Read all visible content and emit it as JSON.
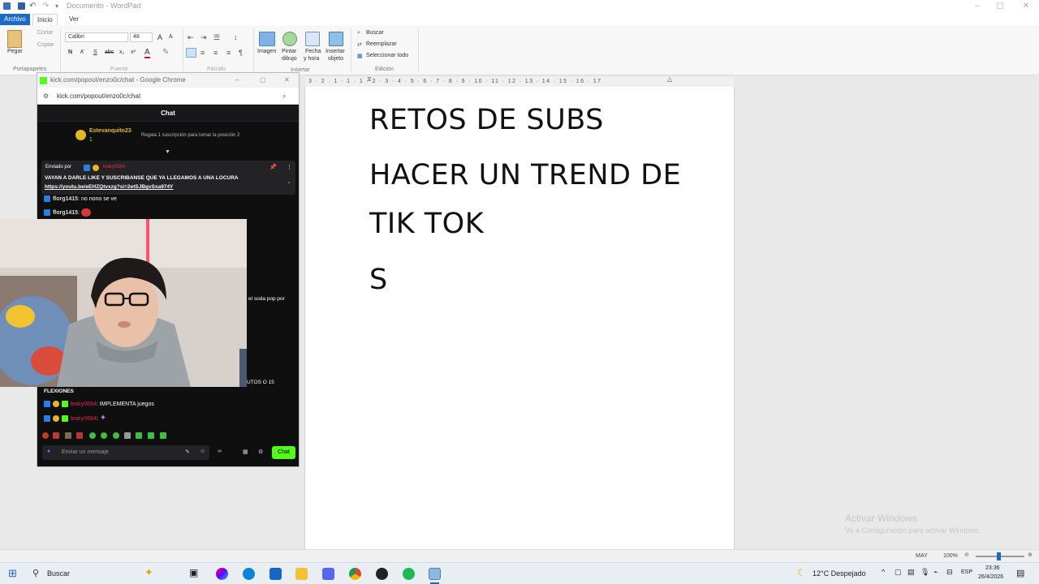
{
  "window": {
    "title": "Documento - WordPad"
  },
  "tabs": {
    "file": "Archivo",
    "home": "Inicio",
    "view": "Ver"
  },
  "ribbon": {
    "paste": "Pegar",
    "cut": "Cortar",
    "copy": "Copiar",
    "clipboard_group": "Portapapeles",
    "font_name": "Calibri",
    "font_size": "48",
    "font_group": "Fuente",
    "paragraph_group": "Párrafo",
    "image": "Imagen",
    "paint_drawing": "Pintar\ndibujo",
    "paint_line1": "Pintar",
    "paint_line2": "dibujo",
    "date_line1": "Fecha",
    "date_line2": "y hora",
    "insert_line1": "Insertar",
    "insert_line2": "objeto",
    "insert_group": "Insertar",
    "find": "Buscar",
    "replace": "Reemplazar",
    "select_all": "Seleccionar todo",
    "edit_group": "Edición",
    "bold": "N",
    "italic": "K",
    "underline": "S",
    "strike": "abc",
    "sub": "x₂",
    "sup": "x²"
  },
  "ruler": {
    "marks": "3 · 2 · 1 · 1 · 1 · 2 · 3 · 4 · 5 · 6 · 7 · 8 · 9 · 10 · 11 · 12 · 13 · 14 · 15 · 16 · 17"
  },
  "document": {
    "lines": [
      "RETOS DE SUBS",
      "HACER UN TREND DE",
      "TIK TOK",
      "S"
    ]
  },
  "chrome": {
    "title": "kick.com/popout/enzo0c/chat - Google Chrome",
    "url": "kick.com/popout/enzo0c/chat",
    "chat_header": "Chat",
    "top_user": "Estevanquito23",
    "top_count": "1",
    "gift_text": "Regala 1 suscripción para tomar la posición 2",
    "pinned_by": "Enviado por",
    "pinned_user": "leaky0694",
    "pinned_message": "VAYAN A DARLE LIKE Y SUSCRIBANSE QUE YA LLEGAMOS A UNA LOCURA",
    "pinned_link": "https://youtu.be/eEHZQtvxzg?si=2etSJBgvSxa974Y",
    "msg1_user": "florg1415",
    "msg1_text": ": no nono se ve",
    "msg2_user": "florg1415",
    "msg2_text": ":",
    "partial1": "el soda pop por",
    "partial2": "UTOS O 15",
    "msg3_text": "FLEXIONES",
    "msg4_user": "leaky0694",
    "msg4_text": ": IMPLEMENTA juegos",
    "msg5_user": "leaky0694",
    "msg5_text": ":",
    "input_placeholder": "Enviar un mensaje",
    "chat_button": "Chat"
  },
  "watermark": {
    "line1": "Activar Windows",
    "line2": "Ve a Configuración para activar Windows."
  },
  "statusbar": {
    "caps": "MAY",
    "zoom": "100%"
  },
  "taskbar": {
    "search": "Buscar",
    "weather": "12°C  Despejado",
    "lang": "ESP",
    "time": "23:36",
    "date": "26/4/2026"
  },
  "colors": {
    "accent": "#1b6ac9",
    "kick_green": "#53fc18",
    "chat_bg": "#0f0f10",
    "username_red": "#e4264f"
  }
}
